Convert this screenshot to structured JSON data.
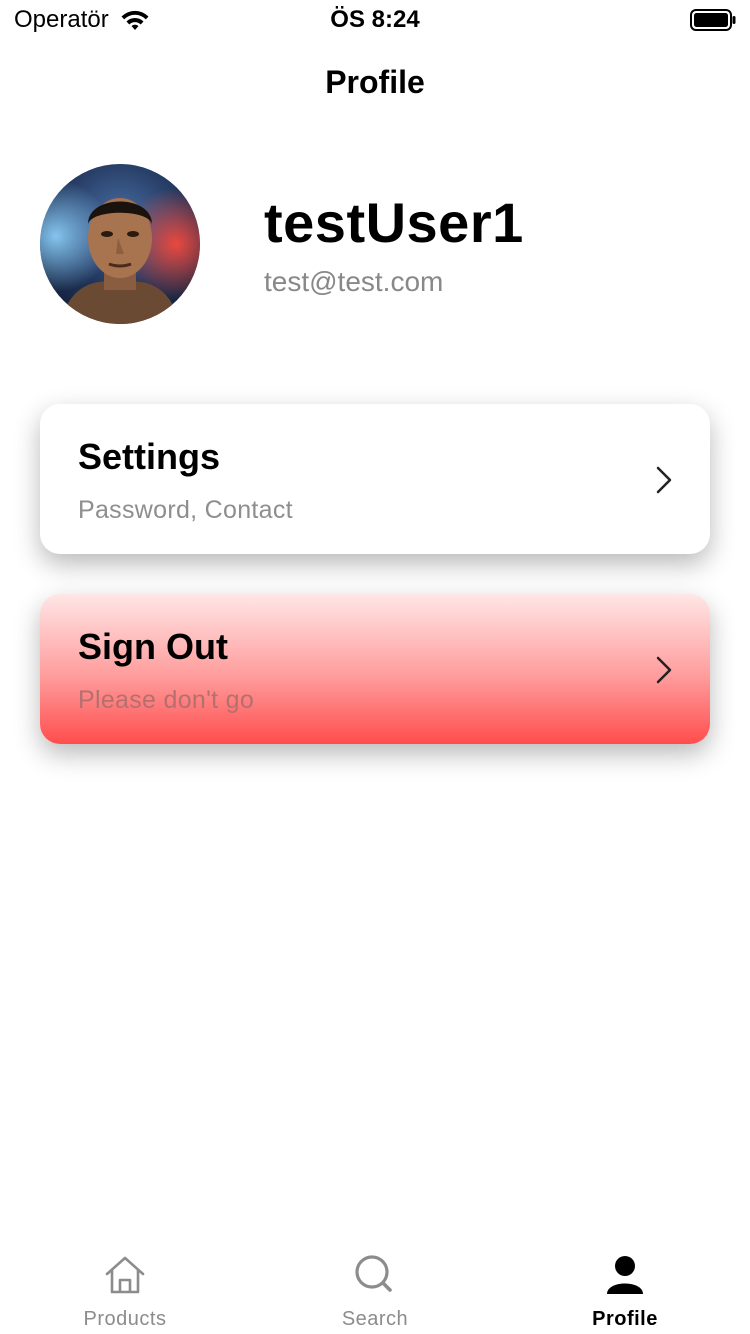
{
  "status_bar": {
    "carrier": "Operatör",
    "time": "ÖS 8:24"
  },
  "nav": {
    "title": "Profile"
  },
  "profile": {
    "username": "testUser1",
    "email": "test@test.com"
  },
  "cards": {
    "settings": {
      "title": "Settings",
      "subtitle": "Password, Contact"
    },
    "signout": {
      "title": "Sign Out",
      "subtitle": "Please don't go"
    }
  },
  "tab_bar": {
    "items": [
      {
        "label": "Products",
        "icon": "house-icon",
        "selected": false
      },
      {
        "label": "Search",
        "icon": "search-icon",
        "selected": false
      },
      {
        "label": "Profile",
        "icon": "person-icon",
        "selected": true
      }
    ]
  },
  "colors": {
    "signout_gradient_top": "#ffe6e6",
    "signout_gradient_bottom": "#ff4d4d",
    "tab_inactive": "#8c8c8c",
    "tab_active": "#000000"
  }
}
